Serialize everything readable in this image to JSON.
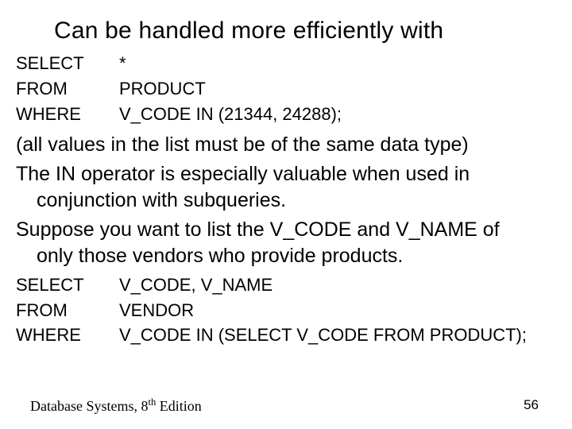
{
  "title": "Can be handled more efficiently with",
  "sql1": {
    "rows": [
      {
        "kw": "SELECT",
        "arg": "*"
      },
      {
        "kw": "FROM",
        "arg": "PRODUCT"
      },
      {
        "kw": "WHERE",
        "arg": "V_CODE IN (21344, 24288);"
      }
    ]
  },
  "body": {
    "p1": "(all values in the list must be of the same data type)",
    "p2a": "The IN operator is especially valuable when used in",
    "p2b": "conjunction with subqueries.",
    "p3a": "Suppose you want to list the V_CODE and V_NAME of",
    "p3b": "only those vendors who provide products."
  },
  "sql2": {
    "rows": [
      {
        "kw": "SELECT",
        "arg": "V_CODE, V_NAME"
      },
      {
        "kw": "FROM",
        "arg": "VENDOR"
      },
      {
        "kw": "WHERE",
        "arg": "V_CODE IN (SELECT V_CODE FROM PRODUCT);"
      }
    ]
  },
  "footer": {
    "text_a": "Database Systems, 8",
    "sup": "th",
    "text_b": " Edition"
  },
  "page_number": "56"
}
